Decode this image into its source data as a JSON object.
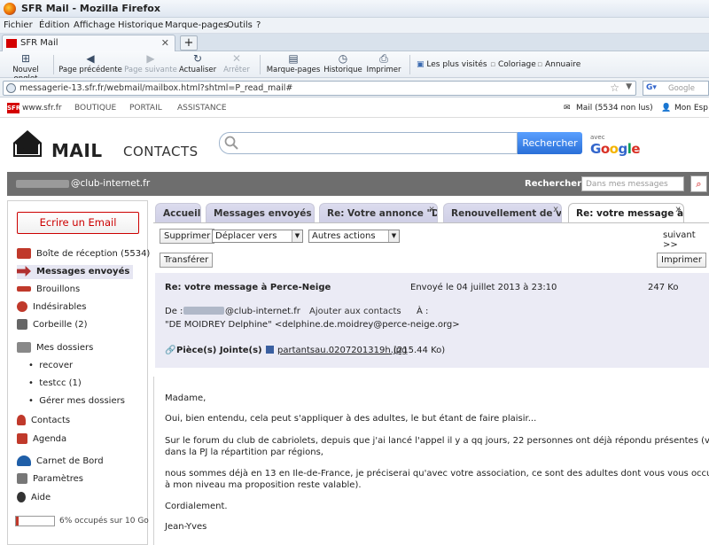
{
  "window": {
    "title": "SFR Mail - Mozilla Firefox"
  },
  "menu": [
    "Fichier",
    "Édition",
    "Affichage",
    "Historique",
    "Marque-pages",
    "Outils",
    "?"
  ],
  "browser_tab": {
    "label": "SFR Mail",
    "new_tab": "+"
  },
  "toolbar": {
    "new_tab": "Nouvel onglet",
    "back": "Page précédente",
    "forward": "Page suivante",
    "reload": "Actualiser",
    "stop": "Arrêter",
    "bookmarks": "Marque-pages",
    "history": "Historique",
    "print": "Imprimer",
    "most_visited": "Les plus visités",
    "coloring": "Coloriage",
    "directory": "Annuaire"
  },
  "url": "messagerie-13.sfr.fr/webmail/mailbox.html?shtml=P_read_mail#",
  "search_engine": {
    "name": "Google",
    "placeholder": "Google"
  },
  "sfr_bar": {
    "logo": "SFR",
    "site": "www.sfr.fr",
    "links": [
      "BOUTIQUE",
      "PORTAIL",
      "ASSISTANCE"
    ],
    "mail_status": "Mail (5534 non lus)",
    "account": "Mon Esp"
  },
  "header": {
    "mail": "MAIL",
    "contacts": "CONTACTS",
    "search_button": "Rechercher",
    "avec": "avec",
    "google": "Google"
  },
  "userbar": {
    "email_domain": "@club-internet.fr",
    "search_label": "Rechercher",
    "search_placeholder": "Dans mes messages"
  },
  "sidebar": {
    "compose": "Ecrire un Email",
    "inbox": "Boîte de réception",
    "inbox_count": "(5534)",
    "sent": "Messages envoyés",
    "drafts": "Brouillons",
    "spam": "Indésirables",
    "trash": "Corbeille",
    "trash_count": "(2)",
    "folders": "Mes dossiers",
    "folder1": "recover",
    "folder2": "testcc",
    "folder2_count": "(1)",
    "manage": "Gérer mes dossiers",
    "contacts": "Contacts",
    "agenda": "Agenda",
    "carnet": "Carnet de Bord",
    "settings": "Paramètres",
    "help": "Aide",
    "quota": "6% occupés sur 10 Go"
  },
  "tabs": {
    "t1": "Accueil",
    "t2": "Messages envoyés",
    "t3": "Re: Votre annonce \"D",
    "t4": "Renouvellement de vo",
    "t5": "Re: votre message à P",
    "close": "x"
  },
  "actions": {
    "delete": "Supprimer",
    "move": "Déplacer vers",
    "other": "Autres actions",
    "next": "suivant >>",
    "forward": "Transférer",
    "print": "Imprimer"
  },
  "message": {
    "subject": "Re: votre message à Perce-Neige",
    "sent": "Envoyé le 04 juillet 2013 à 23:10",
    "size": "247 Ko",
    "from_label": "De :",
    "from": "@club-internet.fr",
    "add_contacts": "Ajouter aux contacts",
    "to_label": "À :",
    "to": "\"DE MOIDREY Delphine\" <delphine.de.moidrey@perce-neige.org>",
    "attachments_label": "Pièce(s) Jointe(s) :",
    "attachment_file": "partantsau.0207201319h.jpg",
    "attachment_size": "(215.44 Ko)"
  },
  "body": {
    "p1": "Madame,",
    "p2": "Oui, bien entendu, cela peut s'appliquer à des adultes, le but étant de faire plaisir...",
    "p3a": "Sur le forum du club de cabriolets, depuis que j'ai lancé l'appel il y a qq jours, 22 personnes ont déjà répondu présentes (voir",
    "p3b": "dans la PJ la répartition par régions,",
    "p4a": "nous sommes déjà en 13 en Ile-de-France, je préciserai qu'avec votre association, ce sont des adultes dont vous vous occupez,",
    "p4b": "à mon niveau ma proposition reste valable).",
    "p5": "Cordialement.",
    "p6": "Jean-Yves"
  },
  "colors": {
    "sfr_red": "#d40000",
    "tab_bg": "#d3d3ea",
    "header_bg": "#ebebf5",
    "search_blue": "#2a6fd8"
  }
}
